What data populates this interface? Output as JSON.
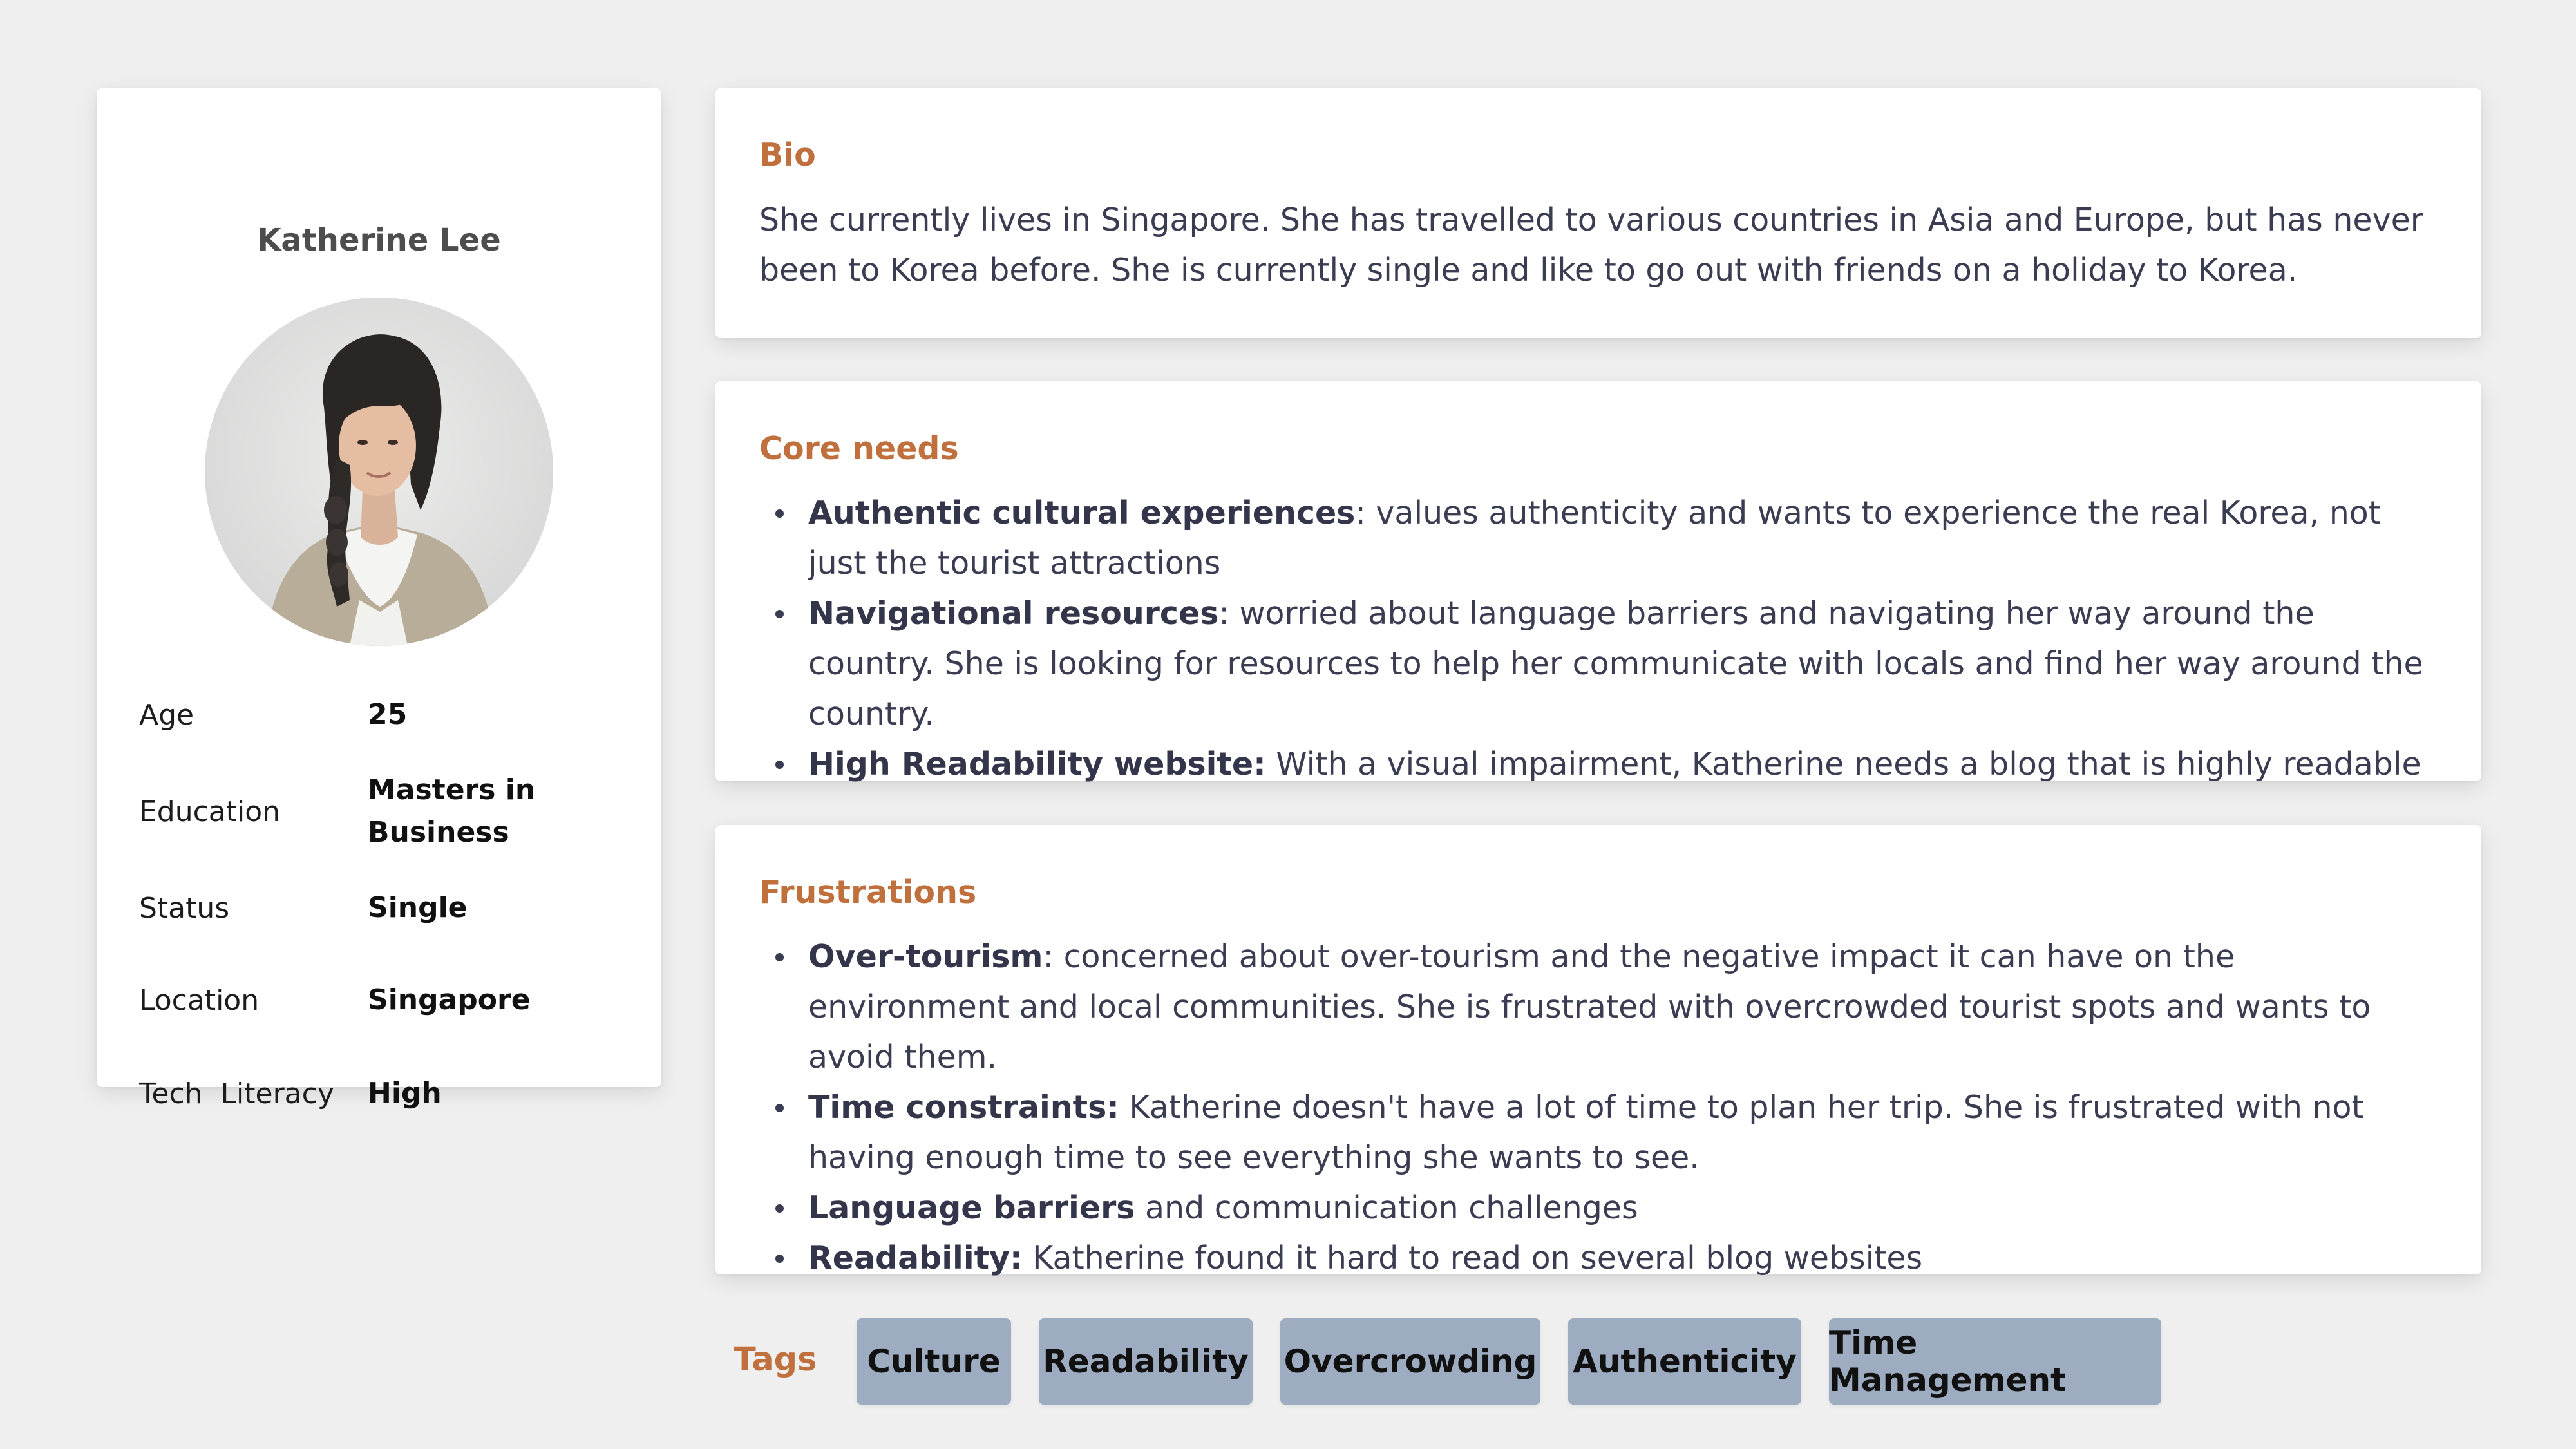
{
  "profile": {
    "name": "Katherine Lee",
    "attributes": [
      {
        "label": "Age",
        "value": "25"
      },
      {
        "label": "Education",
        "value": "Masters in Business"
      },
      {
        "label": "Status",
        "value": "Single"
      },
      {
        "label": "Location",
        "value": "Singapore"
      },
      {
        "label": "Tech  Literacy",
        "value": "High"
      }
    ]
  },
  "bio": {
    "title": "Bio",
    "text": "She currently lives in Singapore. She has travelled to various countries in Asia and Europe, but has never been to Korea before. She is currently single and like to go out with friends on a holiday to Korea."
  },
  "core_needs": {
    "title": "Core needs",
    "items": [
      {
        "bold": "Authentic cultural experiences",
        "text": ": values authenticity and wants to experience the real Korea, not just the tourist attractions"
      },
      {
        "bold": "Navigational resources",
        "text": ": worried about language barriers and navigating her way around the country. She is looking for resources to help her communicate with locals and find her way around the country."
      },
      {
        "bold": "High Readability website:",
        "text": " With a visual impairment, Katherine needs a blog that is highly readable"
      }
    ]
  },
  "frustrations": {
    "title": "Frustrations",
    "items": [
      {
        "bold": "Over-tourism",
        "text": ": concerned about over-tourism and the negative impact it can have on the environment and local communities. She is frustrated with overcrowded tourist spots and wants to avoid them."
      },
      {
        "bold": "Time constraints:",
        "text": " Katherine doesn't have a lot of time to plan her trip. She is frustrated with not having enough time to see everything she wants to see."
      },
      {
        "bold": "Language barriers",
        "text": " and communication challenges"
      },
      {
        "bold": "Readability:",
        "text": " Katherine found it hard to read on several blog websites"
      }
    ]
  },
  "tags": {
    "label": "Tags",
    "items": [
      "Culture",
      "Readability",
      "Overcrowding",
      "Authenticity",
      "Time Management"
    ]
  },
  "colors": {
    "background": "#efefef",
    "accent": "#c0703d",
    "tag_background": "#9eacc1",
    "body_text": "#3a3d52"
  }
}
